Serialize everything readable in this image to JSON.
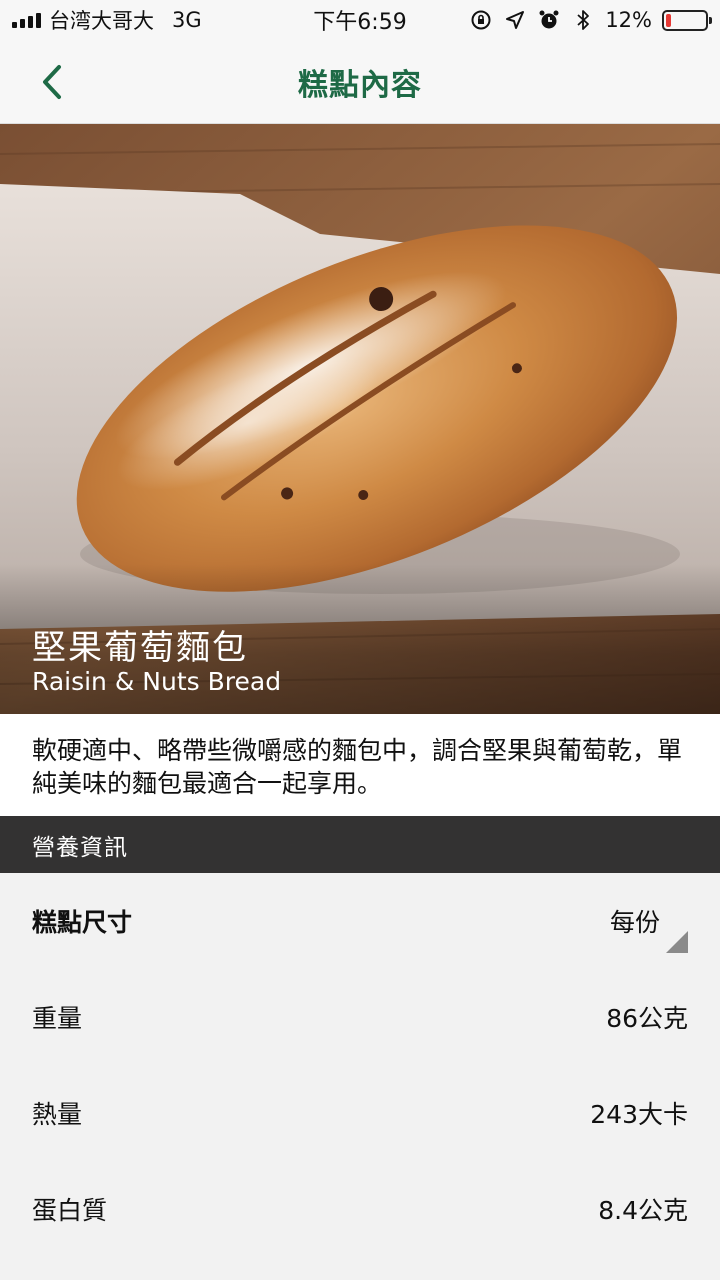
{
  "status_bar": {
    "carrier": "台湾大哥大",
    "network": "3G",
    "time": "下午6:59",
    "battery_percent": "12%",
    "battery_level": 0.12,
    "battery_color": "#e53935"
  },
  "header": {
    "title": "糕點內容",
    "back_icon": "chevron-left-icon",
    "accent_color": "#1e6a46"
  },
  "product": {
    "name_zh": "堅果葡萄麵包",
    "name_en": "Raisin & Nuts Bread",
    "description": "軟硬適中、略帶些微嚼感的麵包中，調合堅果與葡萄乾，單純美味的麵包最適合一起享用。"
  },
  "nutrition": {
    "section_title": "營養資訊",
    "size_label": "糕點尺寸",
    "size_value": "每份",
    "rows": [
      {
        "label": "重量",
        "value": "86公克"
      },
      {
        "label": "熱量",
        "value": "243大卡"
      },
      {
        "label": "蛋白質",
        "value": "8.4公克"
      }
    ]
  }
}
